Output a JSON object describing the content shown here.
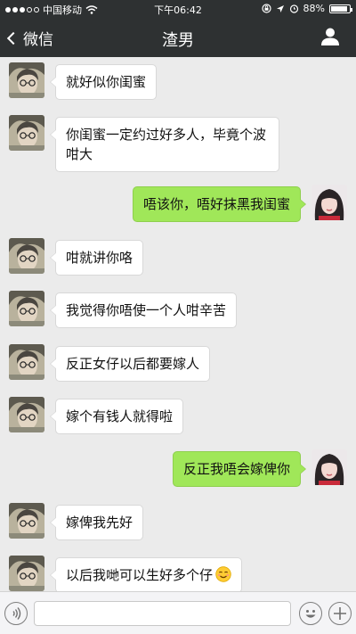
{
  "status_bar": {
    "carrier": "中国移动",
    "time": "下午06:42",
    "battery": "88%",
    "battery_level": 0.88,
    "signal_icon": "signal-dots-icon",
    "wifi_icon": "wifi-icon",
    "lock_icon": "rotation-lock-icon",
    "location_icon": "location-arrow-icon",
    "alarm_icon": "alarm-icon"
  },
  "nav": {
    "back_label": "微信",
    "title": "渣男",
    "back_icon": "chevron-left-icon",
    "profile_icon": "person-icon"
  },
  "messages": [
    {
      "side": "left",
      "text": "就好似你闺蜜"
    },
    {
      "side": "left",
      "text": "你闺蜜一定约过好多人，毕竟个波咁大"
    },
    {
      "side": "right",
      "text": "唔该你，唔好抹黑我闺蜜"
    },
    {
      "side": "left",
      "text": "咁就讲你咯"
    },
    {
      "side": "left",
      "text": "我觉得你唔使一个人咁辛苦"
    },
    {
      "side": "left",
      "text": "反正女仔以后都要嫁人"
    },
    {
      "side": "left",
      "text": "嫁个有钱人就得啦"
    },
    {
      "side": "right",
      "text": "反正我唔会嫁俾你"
    },
    {
      "side": "left",
      "text": "嫁俾我先好"
    },
    {
      "side": "left",
      "text": "以后我哋可以生好多个仔",
      "emoji": "smiling-emoji-icon"
    }
  ],
  "input_bar": {
    "voice_icon": "voice-icon",
    "emoji_icon": "smiley-icon",
    "add_icon": "plus-icon",
    "text_value": ""
  },
  "colors": {
    "header_bg": "#2e3132",
    "chat_bg": "#ebebeb",
    "sent_bubble": "#a0e759",
    "received_bubble": "#ffffff"
  }
}
